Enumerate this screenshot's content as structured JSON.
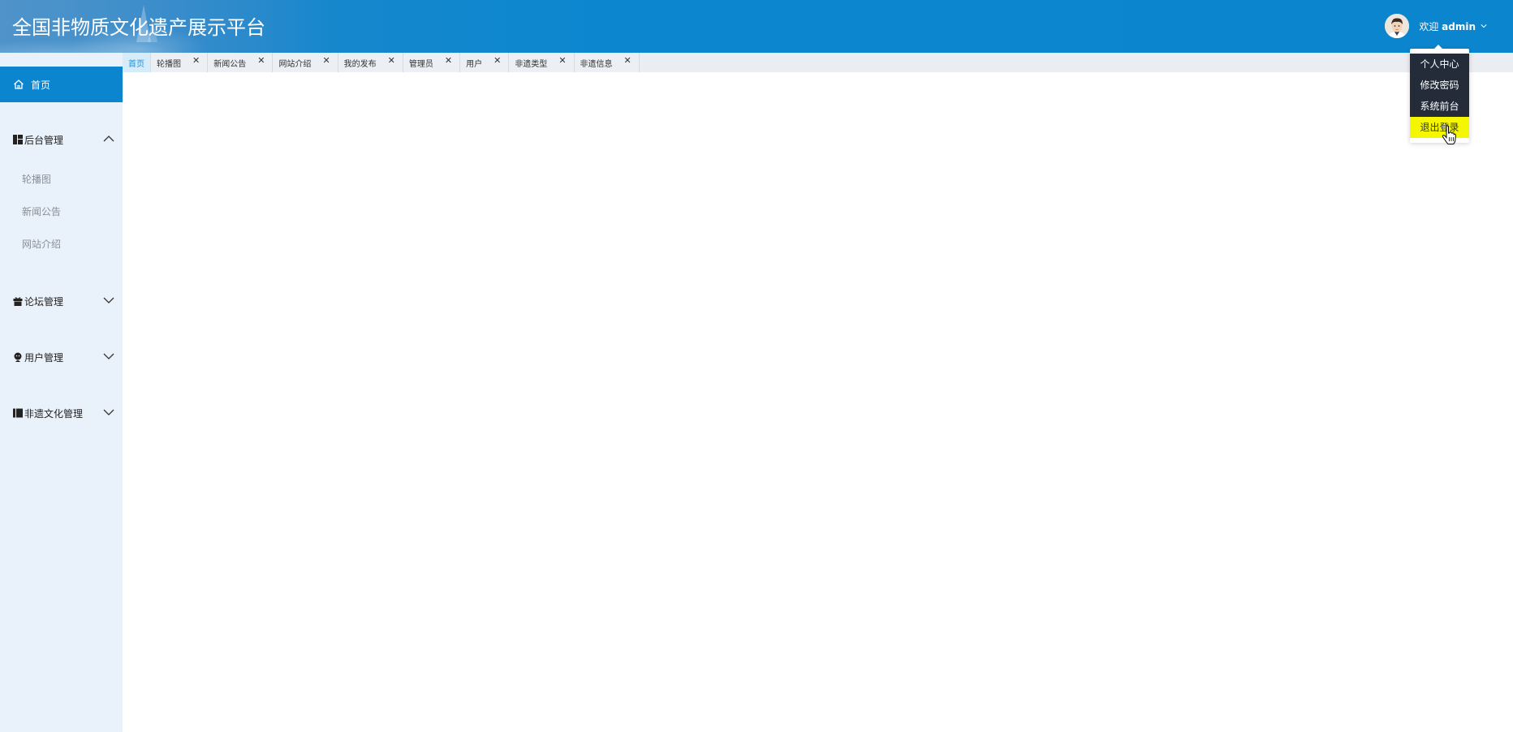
{
  "header": {
    "title": "全国非物质文化遗产展示平台",
    "welcome_prefix": "欢迎",
    "username": "admin",
    "accent_color": "#0b86ce"
  },
  "user_dropdown": {
    "items": [
      {
        "label": "个人中心"
      },
      {
        "label": "修改密码"
      },
      {
        "label": "系统前台"
      },
      {
        "label": "退出登录",
        "hovered": true
      }
    ]
  },
  "sidebar": {
    "home": {
      "label": "首页",
      "icon": "home-icon",
      "active": true
    },
    "groups": [
      {
        "label": "后台管理",
        "icon": "dashboard-icon",
        "expanded": true,
        "items": [
          {
            "label": "轮播图"
          },
          {
            "label": "新闻公告"
          },
          {
            "label": "网站介绍"
          }
        ]
      },
      {
        "label": "论坛管理",
        "icon": "gift-icon",
        "expanded": false
      },
      {
        "label": "用户管理",
        "icon": "user-icon",
        "expanded": false
      },
      {
        "label": "非遗文化管理",
        "icon": "book-icon",
        "expanded": false
      }
    ]
  },
  "tabs": [
    {
      "label": "首页",
      "active": true,
      "closable": false
    },
    {
      "label": "轮播图",
      "closable": true
    },
    {
      "label": "新闻公告",
      "closable": true
    },
    {
      "label": "网站介绍",
      "closable": true
    },
    {
      "label": "我的发布",
      "closable": true
    },
    {
      "label": "管理员",
      "closable": true
    },
    {
      "label": "用户",
      "closable": true
    },
    {
      "label": "非遗类型",
      "closable": true
    },
    {
      "label": "非遗信息",
      "closable": true
    }
  ],
  "tab_close_glyph": "✕"
}
